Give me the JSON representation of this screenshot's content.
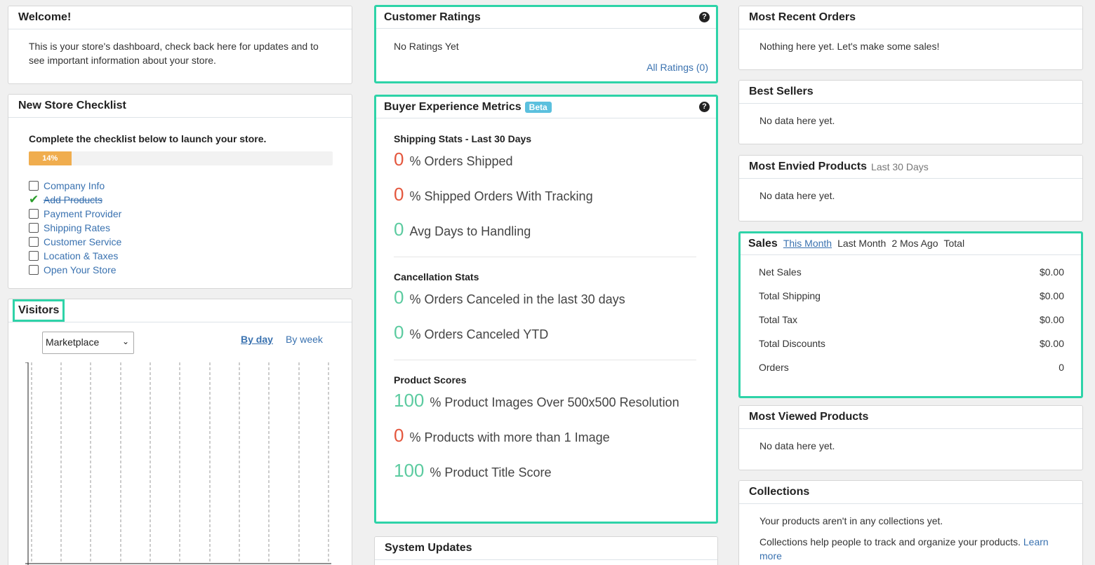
{
  "welcome": {
    "title": "Welcome!",
    "body": "This is your store's dashboard, check back here for updates and to see important information about your store."
  },
  "checklist": {
    "title": "New Store Checklist",
    "intro": "Complete the checklist below to launch your store.",
    "progress_percent": 14,
    "progress_label": "14%",
    "items": [
      {
        "label": "Company Info",
        "done": false
      },
      {
        "label": "Add Products",
        "done": true
      },
      {
        "label": "Payment Provider",
        "done": false
      },
      {
        "label": "Shipping Rates",
        "done": false
      },
      {
        "label": "Customer Service",
        "done": false
      },
      {
        "label": "Location & Taxes",
        "done": false
      },
      {
        "label": "Open Your Store",
        "done": false
      }
    ]
  },
  "visitors": {
    "title": "Visitors",
    "select_value": "Marketplace",
    "by_day": "By day",
    "by_week": "By week"
  },
  "ratings": {
    "title": "Customer Ratings",
    "body": "No Ratings Yet",
    "link": "All Ratings (0)"
  },
  "metrics": {
    "title": "Buyer Experience Metrics",
    "badge": "Beta",
    "sections": [
      {
        "heading": "Shipping Stats - Last 30 Days",
        "rows": [
          {
            "value": "0",
            "label": "% Orders Shipped",
            "color": "red"
          },
          {
            "value": "0",
            "label": "% Shipped Orders With Tracking",
            "color": "red"
          },
          {
            "value": "0",
            "label": "Avg Days to Handling",
            "color": "green"
          }
        ]
      },
      {
        "heading": "Cancellation Stats",
        "rows": [
          {
            "value": "0",
            "label": "% Orders Canceled in the last 30 days",
            "color": "green"
          },
          {
            "value": "0",
            "label": "% Orders Canceled YTD",
            "color": "green"
          }
        ]
      },
      {
        "heading": "Product Scores",
        "rows": [
          {
            "value": "100",
            "label": "% Product Images Over 500x500 Resolution",
            "color": "green"
          },
          {
            "value": "0",
            "label": "% Products with more than 1 Image",
            "color": "red"
          },
          {
            "value": "100",
            "label": "% Product Title Score",
            "color": "green"
          }
        ]
      }
    ]
  },
  "system_updates": {
    "title": "System Updates"
  },
  "recent_orders": {
    "title": "Most Recent Orders",
    "body": "Nothing here yet. Let's make some sales!"
  },
  "best_sellers": {
    "title": "Best Sellers",
    "body": "No data here yet."
  },
  "envied": {
    "title": "Most Envied Products",
    "sub": "Last 30 Days",
    "body": "No data here yet."
  },
  "sales": {
    "title": "Sales",
    "tabs": [
      "This Month",
      "Last Month",
      "2 Mos Ago",
      "Total"
    ],
    "rows": [
      {
        "label": "Net Sales",
        "value": "$0.00"
      },
      {
        "label": "Total Shipping",
        "value": "$0.00"
      },
      {
        "label": "Total Tax",
        "value": "$0.00"
      },
      {
        "label": "Total Discounts",
        "value": "$0.00"
      },
      {
        "label": "Orders",
        "value": "0"
      }
    ]
  },
  "viewed": {
    "title": "Most Viewed Products",
    "body": "No data here yet."
  },
  "collections": {
    "title": "Collections",
    "line1": "Your products aren't in any collections yet.",
    "line2": "Collections help people to track and organize your products.",
    "learn_more": "Learn more"
  },
  "colors": {
    "accent_highlight": "#2ed3a8",
    "link": "#3a72b0",
    "metric_red": "#e4573e",
    "metric_green": "#5ccba0",
    "progress": "#f0ad4e",
    "beta_badge": "#5bc0de"
  }
}
